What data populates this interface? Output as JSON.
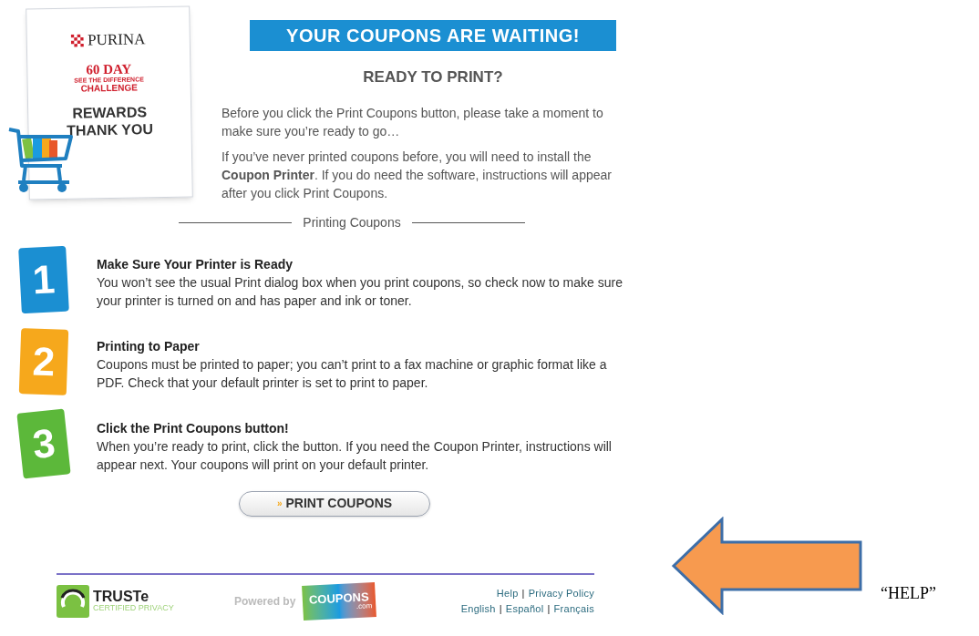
{
  "promo_card": {
    "brand": "PURINA",
    "challenge_days": "60 DAY",
    "challenge_tagline": "SEE THE DIFFERENCE",
    "challenge_name": "CHALLENGE",
    "title_lines": [
      "REWARDS",
      "THANK YOU"
    ]
  },
  "banner": {
    "title": "YOUR COUPONS ARE WAITING!"
  },
  "heading": "READY TO PRINT?",
  "intro": [
    "Before you click the Print Coupons button, please take a moment to make sure you’re ready to go…",
    "If you’ve never printed coupons before, you will need to install the **Coupon Printer**.  If you do need the software, instructions will appear after you click Print Coupons."
  ],
  "section_title": "Printing Coupons",
  "steps": [
    {
      "number": "1",
      "color": "#1b8fd2",
      "title": "Make Sure Your Printer is Ready",
      "text": "You won’t see the usual Print dialog box when you print coupons, so check now to make sure your printer is turned on and has paper and ink or toner."
    },
    {
      "number": "2",
      "color": "#f6a81c",
      "title": "Printing to Paper",
      "text": "Coupons must be printed to paper; you can’t print to a fax machine or graphic format like a PDF. Check that your default printer is set to print to paper."
    },
    {
      "number": "3",
      "color": "#5cb83a",
      "title": "Click the Print Coupons button!",
      "text": "When you’re ready to print, click the button. If you need the Coupon Printer, instructions will appear next. Your coupons will print on your default printer."
    }
  ],
  "print_button": {
    "prefix": "»",
    "label": "PRINT COUPONS"
  },
  "footer": {
    "truste": {
      "name": "TRUSTe",
      "subtitle": "CERTIFIED PRIVACY"
    },
    "powered_by": "Powered by",
    "coupons_logo": {
      "name": "COUPONS",
      "suffix": ".com"
    },
    "separator": "|",
    "link_rows": [
      [
        "Help",
        "Privacy Policy"
      ],
      [
        "English",
        "Español",
        "Français"
      ]
    ]
  },
  "annotation": {
    "label": "“HELP”"
  }
}
